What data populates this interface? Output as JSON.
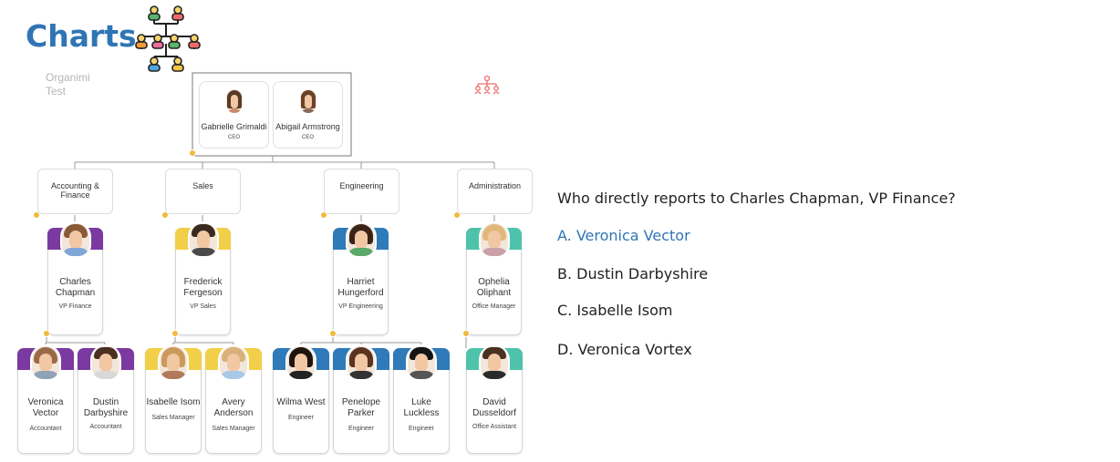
{
  "page": {
    "title": "Charts",
    "org_label_line1": "Organimi",
    "org_label_line2": "Test"
  },
  "colors": {
    "title": "#2f75b5",
    "selected_option": "#2f75b5",
    "purple": "#7b3aa0",
    "yellow": "#f2cf48",
    "blue": "#2f7ab9",
    "teal": "#4fc3aa",
    "badge": "#f2b93b"
  },
  "org": {
    "top": [
      {
        "name": "Gabrielle Grimaldi",
        "role": "CEO"
      },
      {
        "name": "Abigail Armstrong",
        "role": "CEO"
      }
    ],
    "departments": [
      "Accounting & Finance",
      "Sales",
      "Engineering",
      "Administration"
    ],
    "managers": [
      {
        "name_line1": "Charles",
        "name_line2": "Chapman",
        "role": "VP Finance"
      },
      {
        "name_line1": "Frederick",
        "name_line2": "Fergeson",
        "role": "VP Sales"
      },
      {
        "name_line1": "Harriet",
        "name_line2": "Hungerford",
        "role": "VP Engineering"
      },
      {
        "name_line1": "Ophelia Oliphant",
        "name_line2": "",
        "role": "Office Manager"
      }
    ],
    "staff": [
      {
        "name_line1": "Veronica Vector",
        "name_line2": "",
        "role": "Accountant"
      },
      {
        "name_line1": "Dustin",
        "name_line2": "Darbyshire",
        "role": "Accountant"
      },
      {
        "name_line1": "Isabelle Isom",
        "name_line2": "",
        "role": "Sales Manager"
      },
      {
        "name_line1": "Avery Anderson",
        "name_line2": "",
        "role": "Sales Manager"
      },
      {
        "name_line1": "Wilma West",
        "name_line2": "",
        "role": "Engineer"
      },
      {
        "name_line1": "Penelope Parker",
        "name_line2": "",
        "role": "Engineer"
      },
      {
        "name_line1": "Luke Luckless",
        "name_line2": "",
        "role": "Engineer"
      },
      {
        "name_line1": "David",
        "name_line2": "Dusseldorf",
        "role": "Office Assistant"
      }
    ]
  },
  "quiz": {
    "question": "Who directly reports to Charles Chapman, VP Finance?",
    "options": [
      "A. Veronica Vector",
      "B. Dustin Darbyshire",
      "C. Isabelle Isom",
      "D. Veronica Vortex"
    ],
    "selected_index": 0
  },
  "icons": {
    "title_icon": "org-chart-icon",
    "side_icon": "org-chart-outline-icon"
  }
}
